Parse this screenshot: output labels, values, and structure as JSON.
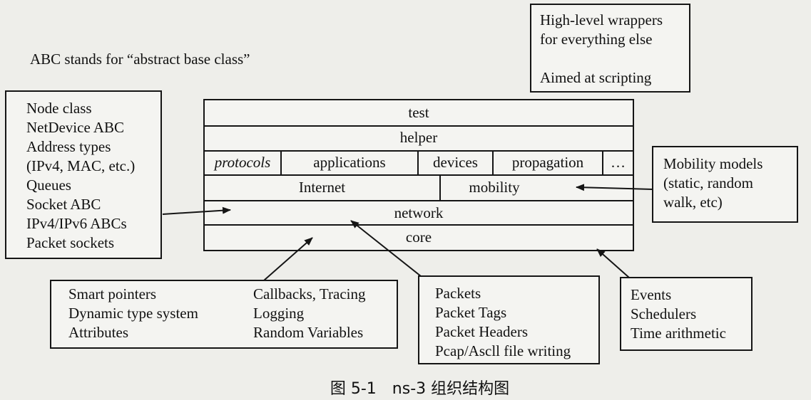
{
  "note": "ABC stands for “abstract base class”",
  "top_right_box": {
    "lines": [
      "High-level wrappers",
      "for everything else",
      "",
      "Aimed at scripting"
    ]
  },
  "left_box": {
    "lines": [
      "Node class",
      "NetDevice ABC",
      "Address types",
      "(IPv4, MAC, etc.)",
      "Queues",
      "Socket ABC",
      "IPv4/IPv6 ABCs",
      "Packet sockets"
    ]
  },
  "stack": {
    "test": "test",
    "helper": "helper",
    "protocols": "protocols",
    "applications": "applications",
    "devices": "devices",
    "propagation": "propagation",
    "ellipsis": "…",
    "internet": "Internet",
    "mobility": "mobility",
    "network": "network",
    "core": "core"
  },
  "mobility_box": {
    "lines": [
      "Mobility models",
      "(static, random",
      "walk, etc)"
    ]
  },
  "core_box": {
    "col1": [
      "Smart pointers",
      "Dynamic type system",
      "Attributes"
    ],
    "col2": [
      "Callbacks, Tracing",
      "Logging",
      "Random Variables"
    ]
  },
  "packets_box": {
    "lines": [
      "Packets",
      "Packet Tags",
      "Packet Headers",
      "Pcap/Ascll file writing"
    ]
  },
  "events_box": {
    "lines": [
      "Events",
      "Schedulers",
      "Time arithmetic"
    ]
  },
  "caption": "图 5-1　ns-3 组织结构图"
}
